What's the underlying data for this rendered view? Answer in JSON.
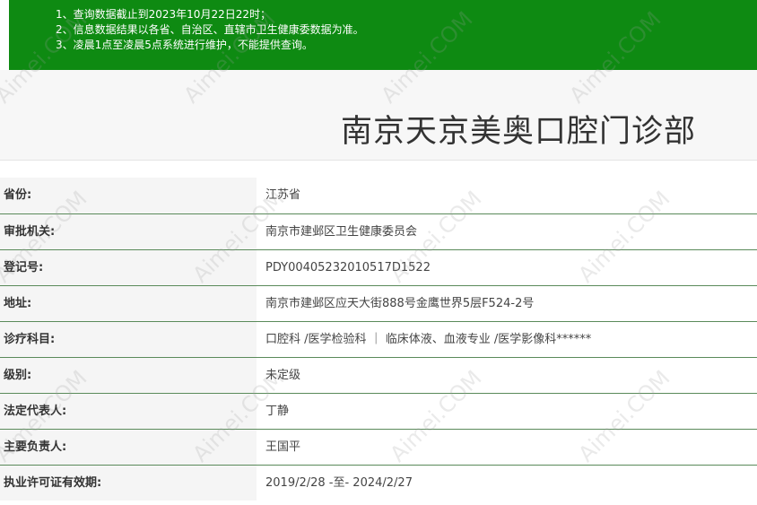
{
  "notice": {
    "lines": [
      "1、查询数据截止到2023年10月22日22时；",
      "2、信息数据结果以各省、自治区、直辖市卫生健康委数据为准。",
      "3、凌晨1点至凌晨5点系统进行维护，不能提供查询。"
    ]
  },
  "title": "南京天京美奥口腔门诊部",
  "rows": [
    {
      "label": "省份:",
      "value": "江苏省"
    },
    {
      "label": "审批机关:",
      "value": "南京市建邺区卫生健康委员会"
    },
    {
      "label": "登记号:",
      "value": "PDY00405232010517D1522"
    },
    {
      "label": "地址:",
      "value": "南京市建邺区应天大街888号金鹰世界5层F524-2号"
    },
    {
      "label": "诊疗科目:",
      "value": "口腔科 /医学检验科 ｜ 临床体液、血液专业 /医学影像科******"
    },
    {
      "label": "级别:",
      "value": "未定级"
    },
    {
      "label": "法定代表人:",
      "value": "丁静"
    },
    {
      "label": "主要负责人:",
      "value": "王国平"
    },
    {
      "label": "执业许可证有效期:",
      "value": "2019/2/28 -至- 2024/2/27"
    }
  ],
  "watermark": {
    "text": "Aimei.COM"
  },
  "colors": {
    "notice_bg": "#0e8a12",
    "row_border": "#5a8a5a",
    "label_bg": "#f5f5f5"
  }
}
